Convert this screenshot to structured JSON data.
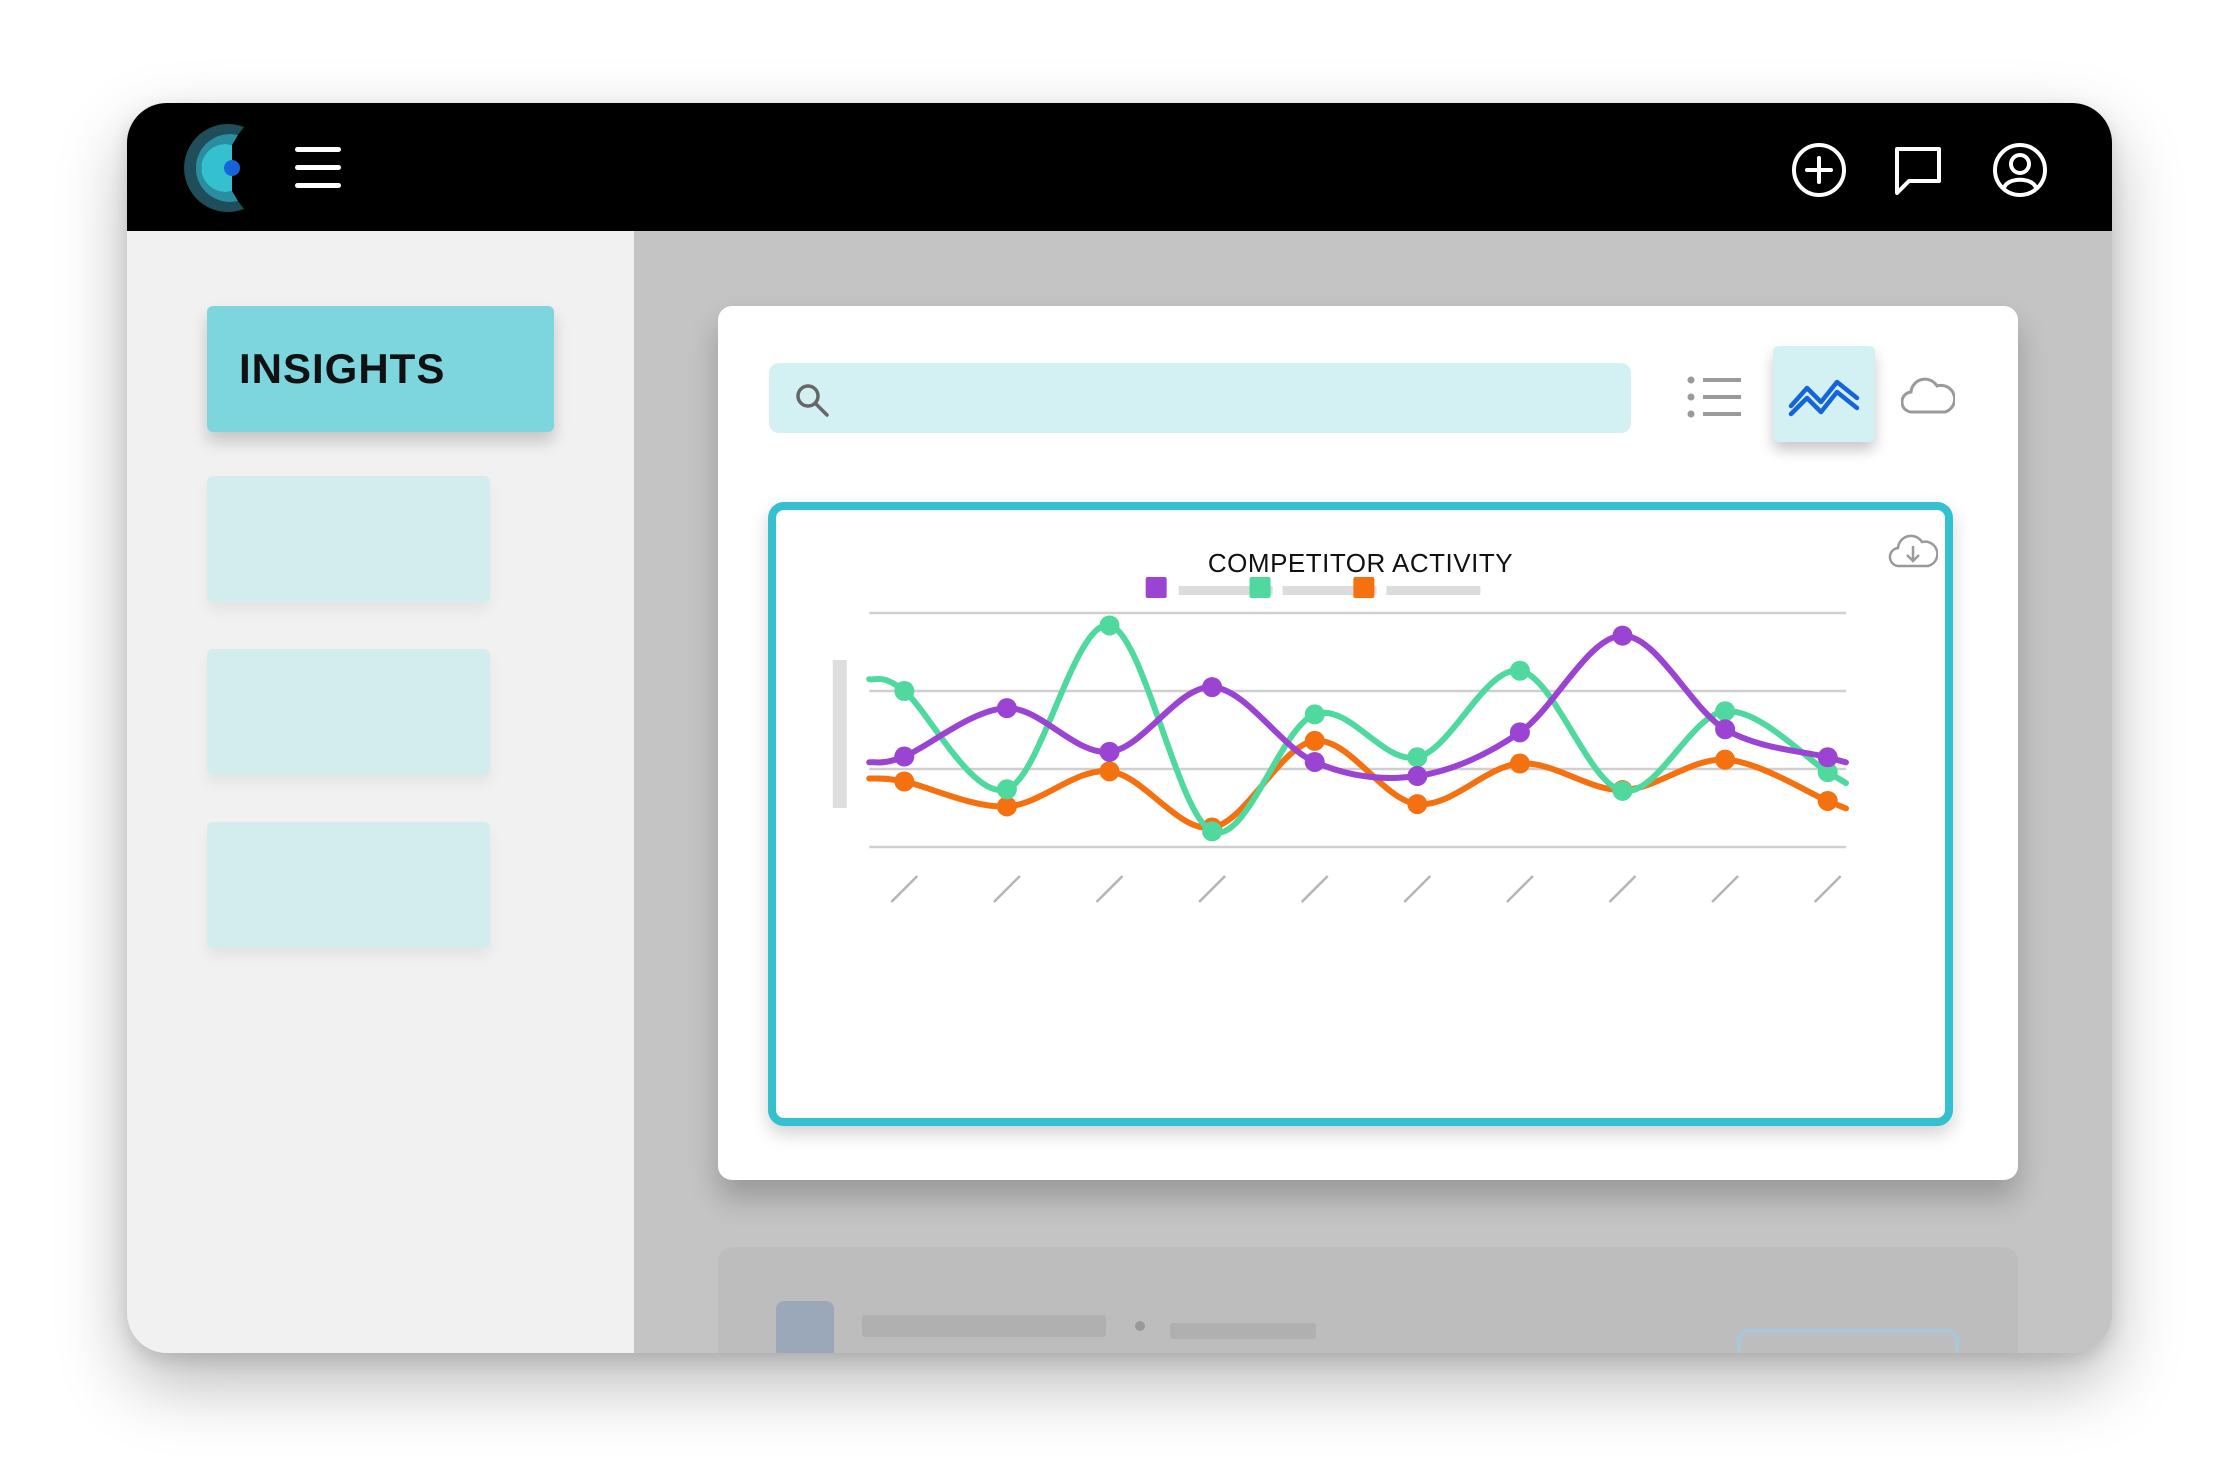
{
  "app": {
    "menu_icon": "hamburger-menu-icon",
    "header_actions": [
      {
        "icon": "add-circle-icon"
      },
      {
        "icon": "chat-bubble-icon"
      },
      {
        "icon": "user-profile-icon"
      }
    ]
  },
  "sidebar": {
    "items": [
      {
        "label": "INSIGHTS",
        "active": true
      },
      {
        "label": "",
        "active": false
      },
      {
        "label": "",
        "active": false
      },
      {
        "label": "",
        "active": false
      }
    ]
  },
  "toolbar": {
    "search_placeholder": "",
    "search_icon": "search-icon",
    "views": [
      {
        "icon": "list-view-icon",
        "active": false
      },
      {
        "icon": "line-chart-icon",
        "active": true
      },
      {
        "icon": "cloud-icon",
        "active": false
      }
    ]
  },
  "colors": {
    "accent": "#35c0d0",
    "nav_active": "#7dd5de",
    "series_purple": "#9b44d4",
    "series_green": "#4fd99e",
    "series_orange": "#f5700f"
  },
  "chart_data": {
    "type": "line",
    "title": "COMPETITOR ACTIVITY",
    "xlabel": "",
    "ylabel": "",
    "x": [
      "",
      "",
      "",
      "",
      "",
      "",
      "",
      "",
      "",
      ""
    ],
    "ylim": [
      0,
      3
    ],
    "grid": true,
    "legend": "top-center",
    "series": [
      {
        "color": "#9b44d4",
        "values": [
          1.16,
          1.78,
          1.22,
          2.05,
          1.09,
          0.91,
          1.47,
          2.71,
          1.51,
          1.15
        ]
      },
      {
        "color": "#4fd99e",
        "values": [
          2.0,
          0.74,
          2.84,
          0.2,
          1.7,
          1.15,
          2.26,
          0.72,
          1.74,
          0.96
        ]
      },
      {
        "color": "#f5700f",
        "values": [
          0.84,
          0.52,
          0.97,
          0.25,
          1.36,
          0.55,
          1.07,
          0.73,
          1.12,
          0.59
        ]
      }
    ]
  }
}
